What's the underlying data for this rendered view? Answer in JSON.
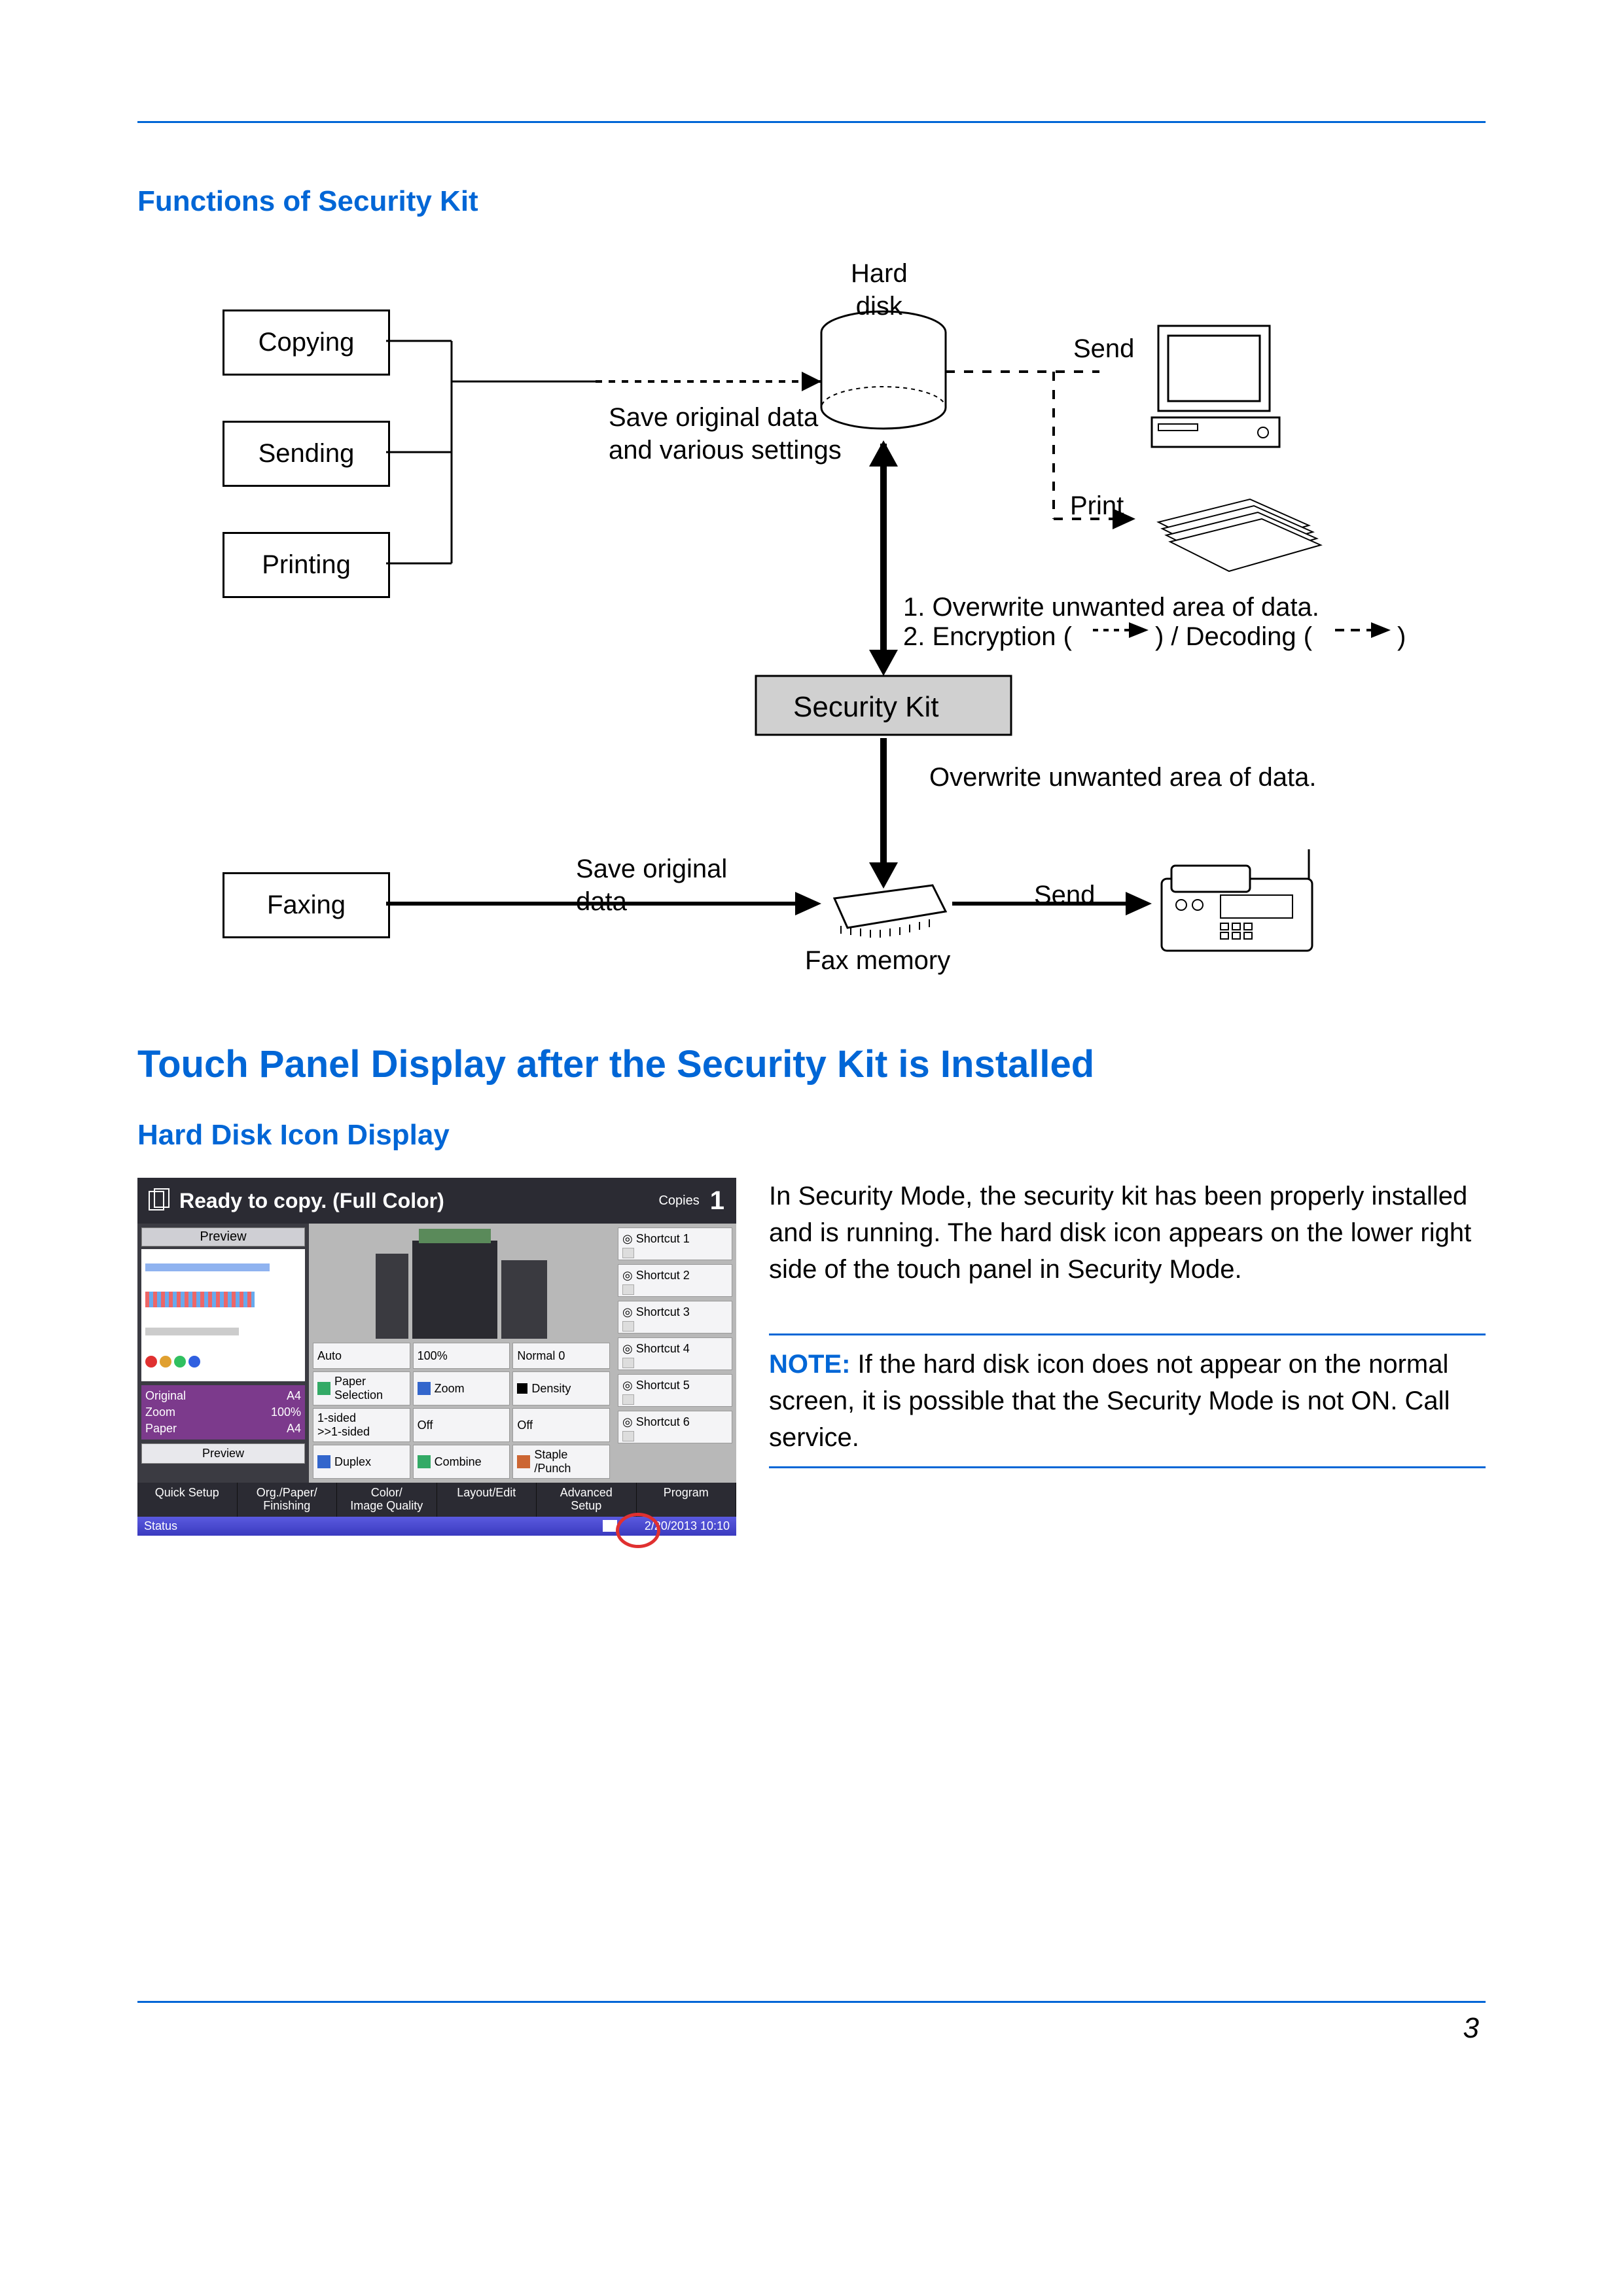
{
  "headings": {
    "h2a": "Functions of Security Kit",
    "h1": "Touch Panel Display after the Security Kit is Installed",
    "h2b": "Hard Disk Icon Display"
  },
  "diagram": {
    "copying": "Copying",
    "sending": "Sending",
    "printing": "Printing",
    "faxing": "Faxing",
    "hard_disk": "Hard\ndisk",
    "save_settings": "Save original data\nand various settings",
    "send": "Send",
    "print": "Print",
    "security_kit": "Security Kit",
    "notes_line1": "1. Overwrite unwanted area of data.",
    "notes_line2_a": "2. Encryption (",
    "notes_line2_b": ") / Decoding (",
    "notes_line2_c": ")",
    "overwrite_below": "Overwrite unwanted area of data.",
    "save_original": "Save original\ndata",
    "fax_memory": "Fax memory",
    "send2": "Send"
  },
  "panel": {
    "title": "Ready to copy. (Full Color)",
    "copies_label": "Copies",
    "copies_value": "1",
    "preview_label": "Preview",
    "info": {
      "original_label": "Original",
      "original_value": "A4",
      "zoom_label": "Zoom",
      "zoom_value": "100%",
      "paper_label": "Paper",
      "paper_value": "A4"
    },
    "preview_btn": "Preview",
    "grid": {
      "r1c1": "Auto",
      "r1c2": "100%",
      "r1c3": "Normal 0",
      "r2c1": "Paper\nSelection",
      "r2c2": "Zoom",
      "r2c3": "Density",
      "r3c1": "1-sided\n>>1-sided",
      "r3c2": "Off",
      "r3c3": "Off",
      "r4c1": "Duplex",
      "r4c2": "Combine",
      "r4c3": "Staple\n/Punch"
    },
    "shortcuts": [
      "Shortcut 1",
      "Shortcut 2",
      "Shortcut 3",
      "Shortcut 4",
      "Shortcut 5",
      "Shortcut 6"
    ],
    "tabs": [
      "Quick Setup",
      "Org./Paper/\nFinishing",
      "Color/\nImage Quality",
      "Layout/Edit",
      "Advanced\nSetup",
      "Program"
    ],
    "status": "Status",
    "datetime": "2/20/2013  10:10"
  },
  "body": {
    "para": "In Security Mode, the security kit has been properly installed and is running. The hard disk icon appears on the lower right side of the touch panel in Security Mode.",
    "note_label": "NOTE:",
    "note_text": " If the hard disk icon does not appear on the normal screen, it is possible that the Security Mode is not ON. Call service."
  },
  "page_number": "3"
}
